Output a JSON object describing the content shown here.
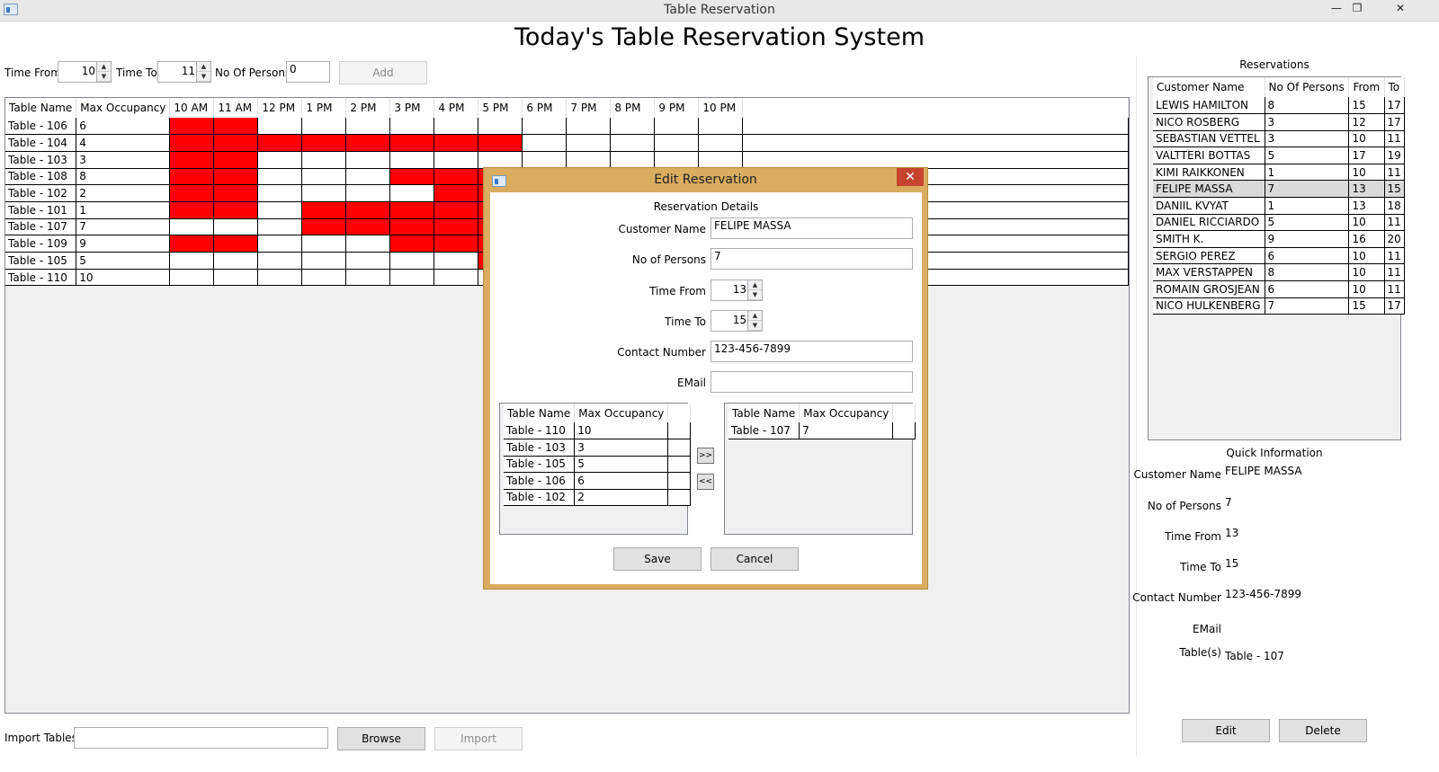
{
  "window": {
    "title": "Table Reservation"
  },
  "app_title": "Today's Table Reservation System",
  "filter": {
    "time_from_label": "Time From",
    "time_from_value": "10",
    "time_to_label": "Time To",
    "time_to_value": "11",
    "persons_label": "No Of Persons",
    "persons_value": "0",
    "add_label": "Add"
  },
  "schedule": {
    "headers": [
      "Table Name",
      "Max Occupancy",
      "10 AM",
      "11 AM",
      "12 PM",
      "1 PM",
      "2 PM",
      "3 PM",
      "4 PM",
      "5 PM",
      "6 PM",
      "7 PM",
      "8 PM",
      "9 PM",
      "10 PM"
    ],
    "reserved_color": "#ff0000",
    "rows": [
      {
        "name": "Table - 106",
        "occ": "6",
        "slots": [
          1,
          1,
          0,
          0,
          0,
          0,
          0,
          0,
          0,
          0,
          0,
          0,
          0
        ]
      },
      {
        "name": "Table - 104",
        "occ": "4",
        "slots": [
          1,
          1,
          1,
          1,
          1,
          1,
          1,
          1,
          0,
          0,
          0,
          0,
          0
        ]
      },
      {
        "name": "Table - 103",
        "occ": "3",
        "slots": [
          1,
          1,
          0,
          0,
          0,
          0,
          0,
          0,
          0,
          0,
          0,
          0,
          0
        ]
      },
      {
        "name": "Table - 108",
        "occ": "8",
        "slots": [
          1,
          1,
          0,
          0,
          0,
          1,
          1,
          1,
          0,
          0,
          0,
          0,
          0
        ]
      },
      {
        "name": "Table - 102",
        "occ": "2",
        "slots": [
          1,
          1,
          0,
          0,
          0,
          0,
          1,
          1,
          0,
          0,
          0,
          0,
          0
        ]
      },
      {
        "name": "Table - 101",
        "occ": "1",
        "slots": [
          1,
          1,
          0,
          1,
          1,
          1,
          1,
          1,
          0,
          0,
          0,
          0,
          0
        ]
      },
      {
        "name": "Table - 107",
        "occ": "7",
        "slots": [
          0,
          0,
          0,
          1,
          1,
          1,
          1,
          1,
          0,
          0,
          0,
          0,
          0
        ]
      },
      {
        "name": "Table - 109",
        "occ": "9",
        "slots": [
          1,
          1,
          0,
          0,
          0,
          1,
          1,
          1,
          0,
          0,
          0,
          0,
          0
        ]
      },
      {
        "name": "Table - 105",
        "occ": "5",
        "slots": [
          0,
          0,
          0,
          0,
          0,
          0,
          0,
          1,
          0,
          0,
          0,
          0,
          0
        ]
      },
      {
        "name": "Table - 110",
        "occ": "10",
        "slots": [
          0,
          0,
          0,
          0,
          0,
          0,
          0,
          0,
          0,
          0,
          0,
          0,
          0
        ]
      }
    ]
  },
  "import": {
    "label": "Import Tables",
    "path": "",
    "browse_label": "Browse",
    "import_label": "Import"
  },
  "dialog": {
    "title": "Edit Reservation",
    "section": "Reservation Details",
    "customer_label": "Customer Name",
    "customer_value": "FELIPE MASSA",
    "persons_label": "No of Persons",
    "persons_value": "7",
    "from_label": "Time From",
    "from_value": "13",
    "to_label": "Time To",
    "to_value": "15",
    "contact_label": "Contact Number",
    "contact_value": "123-456-7899",
    "email_label": "EMail",
    "email_value": "",
    "grid_headers": [
      "Table Name",
      "Max Occupancy"
    ],
    "available": [
      {
        "name": "Table - 110",
        "occ": "10"
      },
      {
        "name": "Table - 103",
        "occ": "3"
      },
      {
        "name": "Table - 105",
        "occ": "5"
      },
      {
        "name": "Table - 106",
        "occ": "6"
      },
      {
        "name": "Table - 102",
        "occ": "2"
      }
    ],
    "assigned": [
      {
        "name": "Table - 107",
        "occ": "7"
      }
    ],
    "move_right_label": ">>",
    "move_left_label": "<<",
    "save_label": "Save",
    "cancel_label": "Cancel"
  },
  "reservations": {
    "title": "Reservations",
    "headers": [
      "Customer Name",
      "No Of Persons",
      "From",
      "To"
    ],
    "rows": [
      {
        "name": "LEWIS HAMILTON",
        "persons": "8",
        "from": "15",
        "to": "17"
      },
      {
        "name": "NICO ROSBERG",
        "persons": "3",
        "from": "12",
        "to": "17"
      },
      {
        "name": "SEBASTIAN VETTEL",
        "persons": "3",
        "from": "10",
        "to": "11"
      },
      {
        "name": "VALTTERI BOTTAS",
        "persons": "5",
        "from": "17",
        "to": "19"
      },
      {
        "name": "KIMI RAIKKONEN",
        "persons": "1",
        "from": "10",
        "to": "11"
      },
      {
        "name": "FELIPE MASSA",
        "persons": "7",
        "from": "13",
        "to": "15",
        "selected": true
      },
      {
        "name": "DANIIL KVYAT",
        "persons": "1",
        "from": "13",
        "to": "18"
      },
      {
        "name": "DANIEL RICCIARDO",
        "persons": "5",
        "from": "10",
        "to": "11"
      },
      {
        "name": "SMITH K.",
        "persons": "9",
        "from": "16",
        "to": "20"
      },
      {
        "name": "SERGIO PEREZ",
        "persons": "6",
        "from": "10",
        "to": "11"
      },
      {
        "name": "MAX VERSTAPPEN",
        "persons": "8",
        "from": "10",
        "to": "11"
      },
      {
        "name": "ROMAIN GROSJEAN",
        "persons": "6",
        "from": "10",
        "to": "11"
      },
      {
        "name": "NICO HULKENBERG",
        "persons": "7",
        "from": "15",
        "to": "17"
      }
    ]
  },
  "quick_info": {
    "title": "Quick Information",
    "customer_label": "Customer Name",
    "customer_value": "FELIPE MASSA",
    "persons_label": "No of Persons",
    "persons_value": "7",
    "from_label": "Time From",
    "from_value": "13",
    "to_label": "Time To",
    "to_value": "15",
    "contact_label": "Contact Number",
    "contact_value": "123-456-7899",
    "email_label": "EMail",
    "email_value": "",
    "tables_label": "Table(s)",
    "tables_value": "Table - 107",
    "edit_label": "Edit",
    "delete_label": "Delete"
  }
}
